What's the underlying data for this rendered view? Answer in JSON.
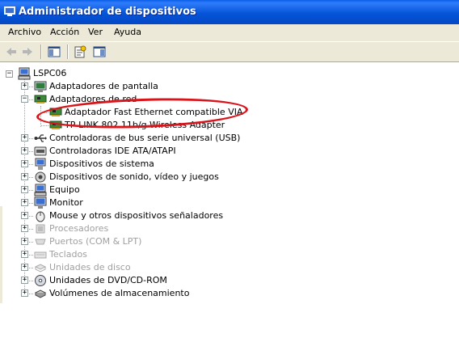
{
  "window": {
    "title": "Administrador de dispositivos"
  },
  "menu": [
    "Archivo",
    "Acción",
    "Ver",
    "Ayuda"
  ],
  "toolbar": {
    "icons": [
      "back-arrow-icon",
      "forward-arrow-icon",
      "show-hide-console-tree-icon",
      "properties-icon",
      "help-icon"
    ]
  },
  "tree": {
    "root": "LSPC06",
    "items": [
      {
        "label": "Adaptadores de pantalla",
        "icon": "display-adapter-icon",
        "expander": "+",
        "disabled": false
      },
      {
        "label": "Adaptadores de red",
        "icon": "network-adapter-icon",
        "expander": "−",
        "disabled": false,
        "children": [
          {
            "label": "Adaptador Fast Ethernet compatible VIA",
            "icon": "network-card-icon"
          },
          {
            "label": "TP-LINK 802.11b/g Wireless Adapter",
            "icon": "network-card-icon"
          }
        ]
      },
      {
        "label": "Controladoras de bus serie universal (USB)",
        "icon": "usb-icon",
        "expander": "+",
        "disabled": false
      },
      {
        "label": "Controladoras IDE ATA/ATAPI",
        "icon": "ide-controller-icon",
        "expander": "+",
        "disabled": false
      },
      {
        "label": "Dispositivos de sistema",
        "icon": "system-device-icon",
        "expander": "+",
        "disabled": false
      },
      {
        "label": "Dispositivos de sonido, vídeo y juegos",
        "icon": "sound-icon",
        "expander": "+",
        "disabled": false
      },
      {
        "label": "Equipo",
        "icon": "computer-icon",
        "expander": "+",
        "disabled": false
      },
      {
        "label": "Monitor",
        "icon": "monitor-icon",
        "expander": "+",
        "disabled": false
      },
      {
        "label": "Mouse y otros dispositivos señaladores",
        "icon": "mouse-icon",
        "expander": "+",
        "disabled": false
      },
      {
        "label": "Procesadores",
        "icon": "processor-icon",
        "expander": "+",
        "disabled": true
      },
      {
        "label": "Puertos (COM & LPT)",
        "icon": "port-icon",
        "expander": "+",
        "disabled": true
      },
      {
        "label": "Teclados",
        "icon": "keyboard-icon",
        "expander": "+",
        "disabled": true
      },
      {
        "label": "Unidades de disco",
        "icon": "disk-drive-icon",
        "expander": "+",
        "disabled": true
      },
      {
        "label": "Unidades de DVD/CD-ROM",
        "icon": "cdrom-icon",
        "expander": "+",
        "disabled": false
      },
      {
        "label": "Volúmenes de almacenamiento",
        "icon": "storage-volume-icon",
        "expander": "+",
        "disabled": false
      }
    ]
  },
  "colors": {
    "titlebar": "#0654d8",
    "annotation": "#d8151b",
    "disabled_text": "#a0a0a0"
  }
}
